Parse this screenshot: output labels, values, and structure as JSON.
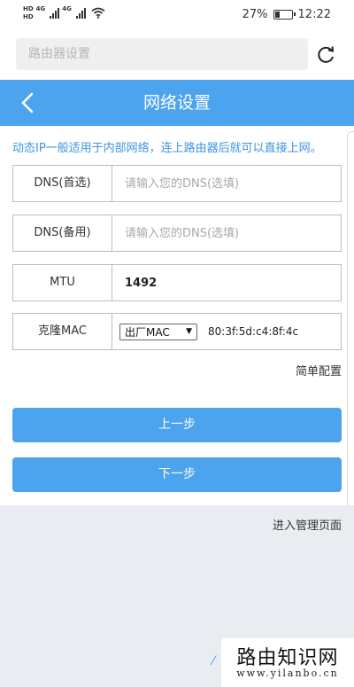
{
  "status_bar": {
    "hd1": "HD",
    "hd2": "HD",
    "net1": "4G",
    "net2": "4G",
    "battery_percent": "27%",
    "battery_level": 0.27,
    "time": "12:22"
  },
  "browser": {
    "url_placeholder": "路由器设置",
    "refresh_icon": "refresh-icon"
  },
  "header": {
    "title": "网络设置",
    "back_icon": "chevron-left-icon"
  },
  "intro_text": "动态IP一般适用于内部网络，连上路由器后就可以直接上网。",
  "fields": {
    "dns_primary": {
      "label": "DNS(首选)",
      "placeholder": "请输入您的DNS(选填)",
      "value": ""
    },
    "dns_secondary": {
      "label": "DNS(备用)",
      "placeholder": "请输入您的DNS(选填)",
      "value": ""
    },
    "mtu": {
      "label": "MTU",
      "value": "1492"
    },
    "clone_mac": {
      "label": "克隆MAC",
      "select_value": "出厂MAC",
      "mac_address": "80:3f:5d:c4:8f:4c"
    }
  },
  "simple_config_link": "简单配置",
  "buttons": {
    "prev": "上一步",
    "next": "下一步"
  },
  "footer": {
    "manage_link": "进入管理页面"
  },
  "watermark": {
    "title": "路由知识网",
    "url": "www.yilanbo.cn"
  },
  "colors": {
    "accent": "#4ca3ee",
    "intro_text": "#3d94e2",
    "footer_bg": "#e9edf2"
  }
}
